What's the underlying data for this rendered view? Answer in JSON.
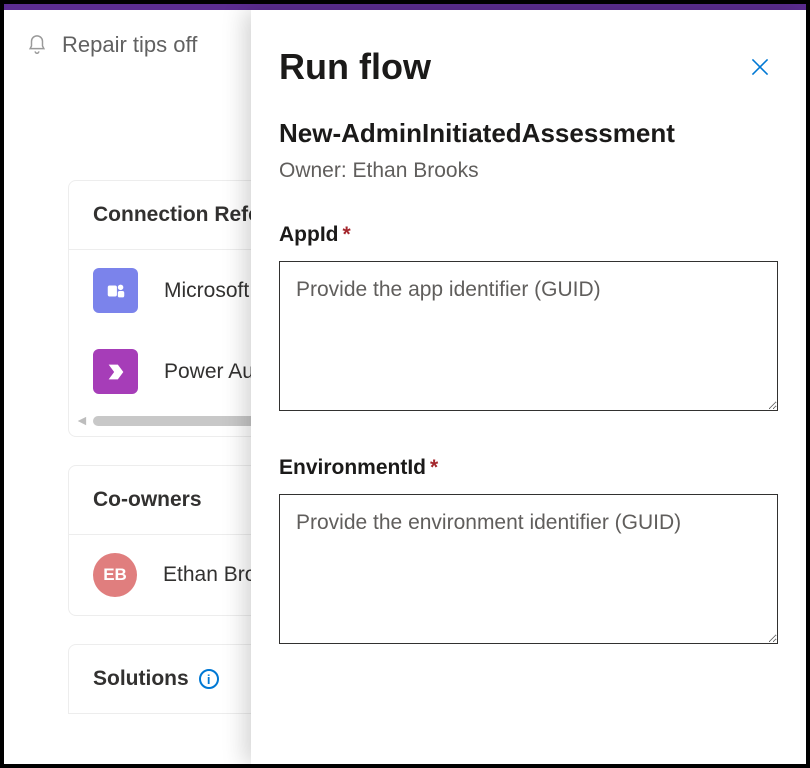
{
  "topbar": {
    "repair_tips": "Repair tips off"
  },
  "cards": {
    "connection_refs": {
      "title": "Connection References",
      "items": [
        {
          "label": "Microsoft Teams",
          "icon": "teams"
        },
        {
          "label": "Power Automate",
          "icon": "power"
        }
      ]
    },
    "coowners": {
      "title": "Co-owners",
      "items": [
        {
          "initials": "EB",
          "label": "Ethan Brooks"
        }
      ]
    },
    "solutions": {
      "title": "Solutions"
    }
  },
  "panel": {
    "title": "Run flow",
    "flow_name": "New-AdminInitiatedAssessment",
    "owner_prefix": "Owner: ",
    "owner": "Ethan Brooks",
    "fields": [
      {
        "label": "AppId",
        "required": "*",
        "placeholder": "Provide the app identifier (GUID)"
      },
      {
        "label": "EnvironmentId",
        "required": "*",
        "placeholder": "Provide the environment identifier (GUID)"
      }
    ]
  }
}
